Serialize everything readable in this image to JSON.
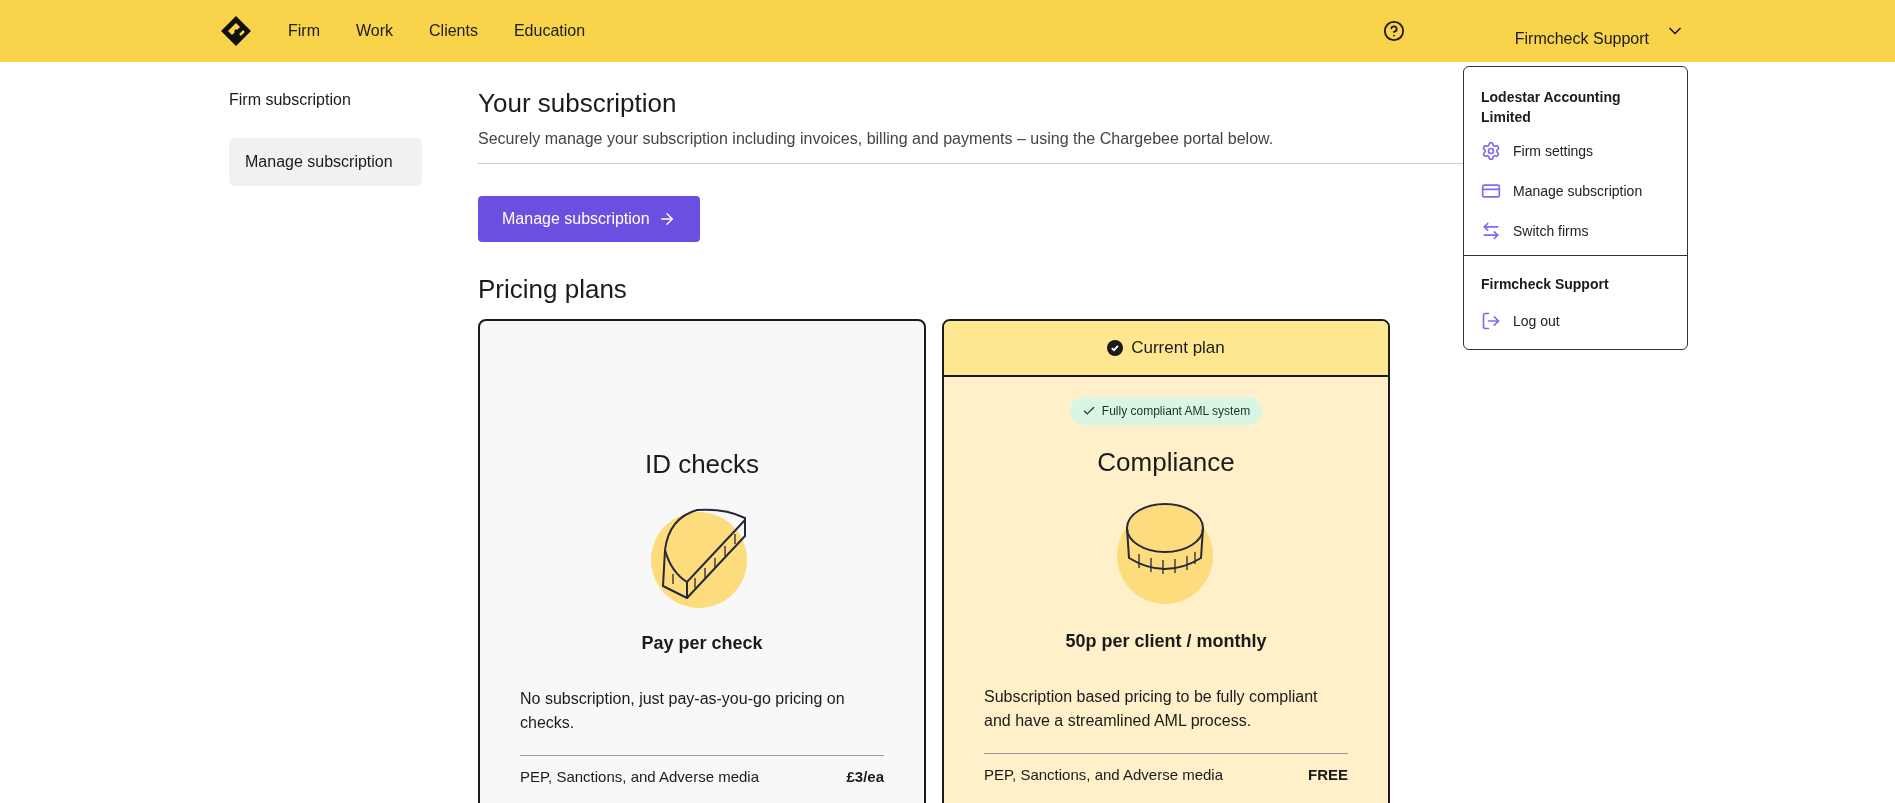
{
  "nav": {
    "links": [
      {
        "label": "Firm"
      },
      {
        "label": "Work"
      },
      {
        "label": "Clients"
      },
      {
        "label": "Education"
      }
    ],
    "user_name": "Firmcheck Support"
  },
  "sidebar": {
    "title": "Firm subscription",
    "items": [
      {
        "label": "Manage subscription",
        "selected": true
      }
    ]
  },
  "main": {
    "title": "Your subscription",
    "subtitle": "Securely manage your subscription including invoices, billing and payments – using the Chargebee portal below.",
    "button": "Manage subscription",
    "pricing_title": "Pricing plans"
  },
  "plans": [
    {
      "current": false,
      "name": "ID checks",
      "price": "Pay per check",
      "description": "No subscription, just pay-as-you-go pricing on checks.",
      "features": [
        {
          "label": "PEP, Sanctions, and Adverse media",
          "value": "£3/ea"
        }
      ]
    },
    {
      "current": true,
      "current_label": "Current plan",
      "badge": "Fully compliant AML system",
      "name": "Compliance",
      "price": "50p per client / monthly",
      "description": "Subscription based pricing to be fully compliant and have a streamlined AML process.",
      "features": [
        {
          "label": "PEP, Sanctions, and Adverse media",
          "value": "FREE"
        }
      ]
    }
  ],
  "menu": {
    "firm_name": "Lodestar Accounting Limited",
    "items": [
      {
        "label": "Firm settings"
      },
      {
        "label": "Manage subscription"
      },
      {
        "label": "Switch firms"
      }
    ],
    "user_name": "Firmcheck Support",
    "logout": "Log out"
  }
}
